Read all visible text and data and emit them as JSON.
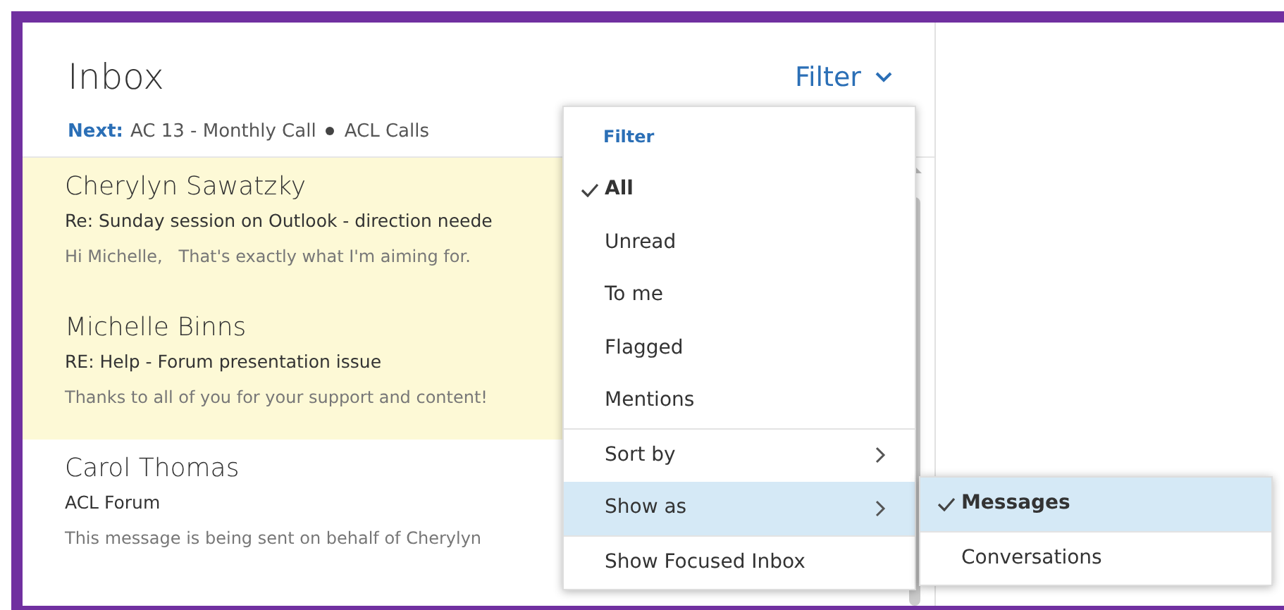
{
  "header": {
    "title": "Inbox",
    "filter_label": "Filter",
    "next_label": "Next:",
    "next_event": "AC 13 - Monthly Call",
    "next_calendar": "ACL Calls"
  },
  "messages": [
    {
      "sender": "Cherylyn Sawatzky",
      "subject": "Re: Sunday session on Outlook - direction neede",
      "preview": "Hi Michelle,   That's exactly what I'm aiming for.",
      "highlighted": true
    },
    {
      "sender": "Michelle Binns",
      "subject": "RE: Help - Forum presentation issue",
      "preview": "Thanks to all of you for your support and content!",
      "highlighted": true
    },
    {
      "sender": "Carol Thomas",
      "subject": "ACL Forum",
      "preview": "This message is being sent on behalf of Cherylyn",
      "highlighted": false
    }
  ],
  "filter_menu": {
    "title": "Filter",
    "items": [
      {
        "kind": "option",
        "label": "All",
        "checked": true
      },
      {
        "kind": "option",
        "label": "Unread",
        "checked": false
      },
      {
        "kind": "option",
        "label": "To me",
        "checked": false
      },
      {
        "kind": "option",
        "label": "Flagged",
        "checked": false
      },
      {
        "kind": "option",
        "label": "Mentions",
        "checked": false
      },
      {
        "kind": "submenu",
        "label": "Sort by",
        "selected": false
      },
      {
        "kind": "submenu",
        "label": "Show as",
        "selected": true
      },
      {
        "kind": "action",
        "label": "Show Focused Inbox"
      }
    ]
  },
  "show_as_menu": [
    {
      "label": "Messages",
      "checked": true,
      "selected": true
    },
    {
      "label": "Conversations",
      "checked": false,
      "selected": false
    }
  ]
}
